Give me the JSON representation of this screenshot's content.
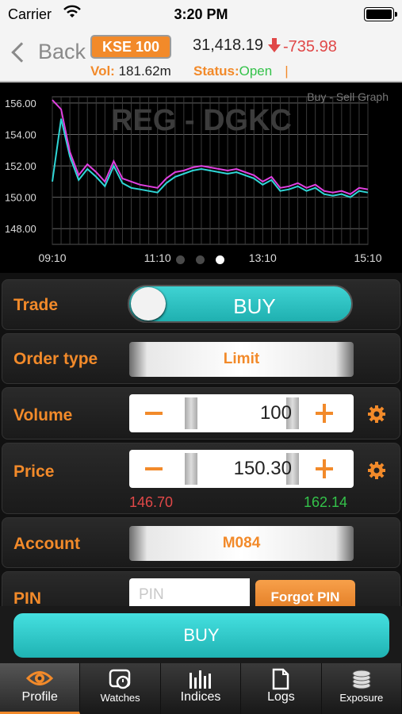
{
  "status_bar": {
    "carrier": "Carrier",
    "time": "3:20 PM"
  },
  "header": {
    "back_label": "Back",
    "index_name": "KSE 100",
    "index_value": "31,418.19",
    "index_change": "-735.98",
    "vol_label": "Vol:",
    "vol_value": "181.62m",
    "status_label": "Status:",
    "status_value": "Open",
    "status_sep": "|"
  },
  "chart_data": {
    "type": "line",
    "watermark": "REG - DGKC",
    "title": "Buy - Sell Graph",
    "x_ticks": [
      "09:10",
      "11:10",
      "13:10",
      "15:10"
    ],
    "y_ticks": [
      "156.00",
      "154.00",
      "152.00",
      "150.00",
      "148.00"
    ],
    "ylim": [
      147,
      156.4
    ],
    "grid": true,
    "series": [
      {
        "color": "#e040e0",
        "x": [
          "09:10",
          "09:20",
          "09:30",
          "09:40",
          "09:50",
          "10:00",
          "10:10",
          "10:20",
          "10:30",
          "10:40",
          "10:50",
          "11:00",
          "11:10",
          "11:20",
          "11:30",
          "11:40",
          "11:50",
          "12:00",
          "12:10",
          "12:20",
          "12:30",
          "12:40",
          "12:50",
          "13:00",
          "13:10",
          "13:20",
          "13:30",
          "13:40",
          "13:50",
          "14:00",
          "14:10",
          "14:20",
          "14:30",
          "14:40",
          "14:50",
          "15:00",
          "15:10"
        ],
        "values": [
          156.2,
          155.6,
          152.9,
          151.4,
          152.1,
          151.6,
          151.0,
          152.3,
          151.2,
          151.0,
          150.8,
          150.7,
          150.6,
          151.2,
          151.6,
          151.7,
          151.9,
          152.0,
          151.9,
          151.8,
          151.7,
          151.8,
          151.6,
          151.4,
          151.0,
          151.3,
          150.6,
          150.7,
          150.9,
          150.6,
          150.8,
          150.4,
          150.3,
          150.4,
          150.2,
          150.6,
          150.5
        ]
      },
      {
        "color": "#2fd6d6",
        "x": [
          "09:10",
          "09:20",
          "09:30",
          "09:40",
          "09:50",
          "10:00",
          "10:10",
          "10:20",
          "10:30",
          "10:40",
          "10:50",
          "11:00",
          "11:10",
          "11:20",
          "11:30",
          "11:40",
          "11:50",
          "12:00",
          "12:10",
          "12:20",
          "12:30",
          "12:40",
          "12:50",
          "13:00",
          "13:10",
          "13:20",
          "13:30",
          "13:40",
          "13:50",
          "14:00",
          "14:10",
          "14:20",
          "14:30",
          "14:40",
          "14:50",
          "15:00",
          "15:10"
        ],
        "values": [
          151.0,
          155.0,
          152.6,
          151.1,
          151.8,
          151.3,
          150.7,
          152.0,
          150.9,
          150.6,
          150.5,
          150.4,
          150.3,
          150.9,
          151.3,
          151.5,
          151.7,
          151.8,
          151.7,
          151.6,
          151.5,
          151.6,
          151.4,
          151.2,
          150.8,
          151.1,
          150.4,
          150.5,
          150.7,
          150.4,
          150.6,
          150.2,
          150.1,
          150.2,
          150.0,
          150.4,
          150.3
        ]
      }
    ]
  },
  "form": {
    "trade_label": "Trade",
    "trade_value": "BUY",
    "order_type_label": "Order type",
    "order_type_value": "Limit",
    "volume_label": "Volume",
    "volume_value": "100",
    "price_label": "Price",
    "price_value": "150.30",
    "price_low": "146.70",
    "price_high": "162.14",
    "account_label": "Account",
    "account_value": "M084",
    "pin_label": "PIN",
    "pin_placeholder": "PIN",
    "forgot_pin_label": "Forgot PIN"
  },
  "buy_button": "BUY",
  "tabs": [
    {
      "label": "Profile",
      "icon": "eye-icon",
      "active": true
    },
    {
      "label": "Watches",
      "icon": "watch-icon"
    },
    {
      "label": "Indices",
      "icon": "bars-icon"
    },
    {
      "label": "Logs",
      "icon": "document-icon"
    },
    {
      "label": "Exposure",
      "icon": "coins-icon"
    }
  ],
  "colors": {
    "accent": "#f28a2a",
    "teal": "#2fc6c6",
    "up": "#34c24a",
    "down": "#e04848"
  }
}
